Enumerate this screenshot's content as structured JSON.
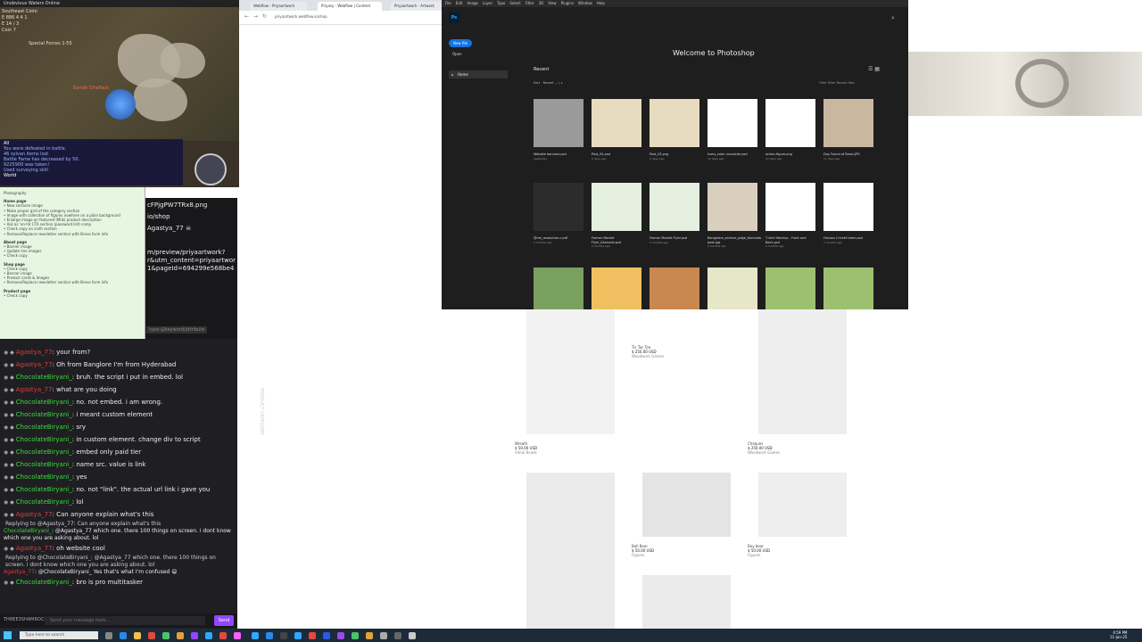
{
  "game": {
    "title": "Unobvious Waters Online",
    "location": "Southeast Coiro",
    "stat1": "E 886 4 4 1",
    "stat2": "E 14 / 3",
    "stat3": "Coin 7",
    "party": "Special Forces 1-55",
    "enemy": "Bandit Chieftain",
    "chat_tab": "All",
    "chat_lines": [
      "You were defeated in battle.",
      "46 sylvan items lost",
      "Battle Fame has decreased by 50.",
      "9225900 was taken!",
      "Used surveying skill"
    ],
    "world_tab": "World"
  },
  "notes": {
    "title": "Photography",
    "sections": [
      {
        "head": "Home page",
        "items": [
          "• New sections image",
          "• Make proper grid of the category section",
          "• Image with collection of figures nowhere on a plain background",
          "• Enlarge image on featured (Milk) product description",
          "• Ask as 'on-hit CTA section (password list) comp",
          "• Check copy on sixth section",
          "• Remove/Replace newsletter section with Brevo form info"
        ]
      },
      {
        "head": "About page",
        "items": [
          "• Banner image",
          "• Update line images",
          "• Check copy"
        ]
      },
      {
        "head": "Shop page",
        "items": [
          "• Check copy",
          "• Banner image",
          "• Product cards & Images",
          "• Remove/Replace newsletter section with Brevo form info"
        ]
      },
      {
        "head": "Product page",
        "items": [
          "• Check copy"
        ]
      }
    ]
  },
  "urlpane": {
    "lines": [
      "cFPjgPW7TRx8.png",
      "io/shop",
      "Agastya_77",
      "m/preview/priyaartwork?",
      "r&utm_content=priyaartwor",
      "1&pageId=694299e568be4"
    ],
    "tag": "type:@keyword/attribute"
  },
  "chat": {
    "messages": [
      {
        "user": "Agastya_77",
        "kind": "agastya",
        "text": ": your from?"
      },
      {
        "user": "Agastya_77",
        "kind": "agastya",
        "text": ": Oh from Banglore I'm from Hyderabad"
      },
      {
        "user": "ChocolateBiryani_",
        "kind": "choco",
        "text": ": bruh. the script i put in embed. lol"
      },
      {
        "user": "Agastya_77",
        "kind": "agastya",
        "text": ": what are you doing"
      },
      {
        "user": "ChocolateBiryani_",
        "kind": "choco",
        "text": ": no. not embed. i am wrong."
      },
      {
        "user": "ChocolateBiryani_",
        "kind": "choco",
        "text": ": i meant custom element"
      },
      {
        "user": "ChocolateBiryani_",
        "kind": "choco",
        "text": ": sry"
      },
      {
        "user": "ChocolateBiryani_",
        "kind": "choco",
        "text": ": in custom element. change div to script"
      },
      {
        "user": "ChocolateBiryani_",
        "kind": "choco",
        "text": ": embed only paid tier"
      },
      {
        "user": "ChocolateBiryani_",
        "kind": "choco",
        "text": ": name src. value is link"
      },
      {
        "user": "ChocolateBiryani_",
        "kind": "choco",
        "text": ": yes"
      },
      {
        "user": "ChocolateBiryani_",
        "kind": "choco",
        "text": ": no. not \"link\". the actual url link i gave you"
      },
      {
        "user": "ChocolateBiryani_",
        "kind": "choco",
        "text": ": lol"
      },
      {
        "user": "Agastya_77",
        "kind": "agastya",
        "text": ": Can anyone explain what's this"
      }
    ],
    "reply1_head": "Replying to @Agastya_77: Can anyone explain what's this",
    "reply1_user": "ChocolateBiryani_",
    "reply1_text": ": @Agastya_77 which one. there 100 things on screen. i dont know which one you are asking about. lol",
    "after_reply1": {
      "user": "Agastya_77",
      "text": ": oh website cool"
    },
    "reply2_head": "Replying to @ChocolateBiryani_: @Agastya_77 which one. there 100 things on screen. i dont know which one you are asking about. lol",
    "reply2_user": "Agastya_77",
    "reply2_text": ": @ChocolateBiryani_ Yes that's what I'm confused 😄",
    "last": {
      "user": "ChocolateBiryani_",
      "text": ": bro is pro multitasker"
    },
    "input_who": "THREE3SHAMROCK",
    "input_placeholder": "Send your message here...",
    "send_label": "Send"
  },
  "browser": {
    "tabs": [
      "Webflow - Priyaartwork",
      "Priyasy - Webflow | Content",
      "Priyaartwork - Artwork"
    ],
    "url": "priyaartwork.webflow.io/shop"
  },
  "photoshop": {
    "menus": [
      "File",
      "Edit",
      "Image",
      "Layer",
      "Type",
      "Select",
      "Filter",
      "3D",
      "View",
      "Plugins",
      "Window",
      "Help"
    ],
    "logo": "Ps",
    "new_file": "New file",
    "open": "Open",
    "home": "Home",
    "welcome": "Welcome to Photoshop",
    "recent": "Recent",
    "sort_label": "Sort",
    "sort_value": "Recent",
    "filter_label": "Filter",
    "filter_placeholder": "Filter Recent files",
    "files": [
      {
        "name": "Website banners.psd",
        "date": "yesterday",
        "thumb": "#9a9a9a"
      },
      {
        "name": "Post_04.psd",
        "date": "9 days ago",
        "thumb": "#e8dcc0"
      },
      {
        "name": "Post_03.png",
        "date": "9 days ago",
        "thumb": "#e8dcc0"
      },
      {
        "name": "Icons_color converter.psd",
        "date": "12 days ago",
        "thumb": "#ffffff"
      },
      {
        "name": "action-figure.png",
        "date": "12 days ago",
        "thumb": "#ffffff"
      },
      {
        "name": "Day Found of Beasi.JPG",
        "date": "11 days ago",
        "thumb": "#c9b7a0"
      },
      {
        "name": "@mk_resolution-c.pdf",
        "date": "2 months ago",
        "thumb": "#2c2c2c"
      },
      {
        "name": "Farmer Market Flyer_Kannada.psd",
        "date": "2 months ago",
        "thumb": "#e4efe0"
      },
      {
        "name": "Farmer Market Flyer.psd",
        "date": "2 months ago",
        "thumb": "#e4efe0"
      },
      {
        "name": "Bangalore_archive_pdge_Kannada post.jpg",
        "date": "2 months ago",
        "thumb": "#d9cfbf"
      },
      {
        "name": "T-shirt Mockup - Front and Back.psd",
        "date": "2 months ago",
        "thumb": "#ffffff"
      },
      {
        "name": "Falcons Cricket team.psd",
        "date": "2 months ago",
        "thumb": "#ffffff"
      },
      {
        "name": "",
        "date": "",
        "thumb": "#7aa060"
      },
      {
        "name": "",
        "date": "",
        "thumb": "#f0c060"
      },
      {
        "name": "",
        "date": "",
        "thumb": "#c88850"
      },
      {
        "name": "",
        "date": "",
        "thumb": "#e6e6c8"
      },
      {
        "name": "",
        "date": "",
        "thumb": "#9cc070"
      },
      {
        "name": "",
        "date": "",
        "thumb": "#9cc070"
      }
    ]
  },
  "shop": {
    "products": [
      {
        "name": "Wreath",
        "price": "$ 50.00 USD",
        "vendor": "Vimal Beads",
        "bg": "#f2f2f2"
      },
      {
        "name": "Tic Tac Toe",
        "price": "$ 250.00 USD",
        "vendor": "Woodwork Games",
        "bg": "#ffffff"
      },
      {
        "name": "Cheques",
        "price": "$ 250.00 USD",
        "vendor": "Woodwork Games",
        "bg": "#eeeeee"
      },
      {
        "name": "",
        "price": "",
        "vendor": "",
        "bg": "#eaeaea"
      },
      {
        "name": "Bell Bear",
        "price": "$ 50.00 USD",
        "vendor": "Figures",
        "bg": "#e4e4e4"
      },
      {
        "name": "Boy bear",
        "price": "$ 50.00 USD",
        "vendor": "Figures",
        "bg": "#eeeeee"
      },
      {
        "name": "",
        "price": "",
        "vendor": "",
        "bg": "#eaeaea"
      }
    ],
    "side_label": "PRODUCT CATEGORY"
  },
  "taskbar": {
    "search_placeholder": "Type here to search",
    "time": "4:59 PM",
    "date": "11-Jan-25"
  }
}
